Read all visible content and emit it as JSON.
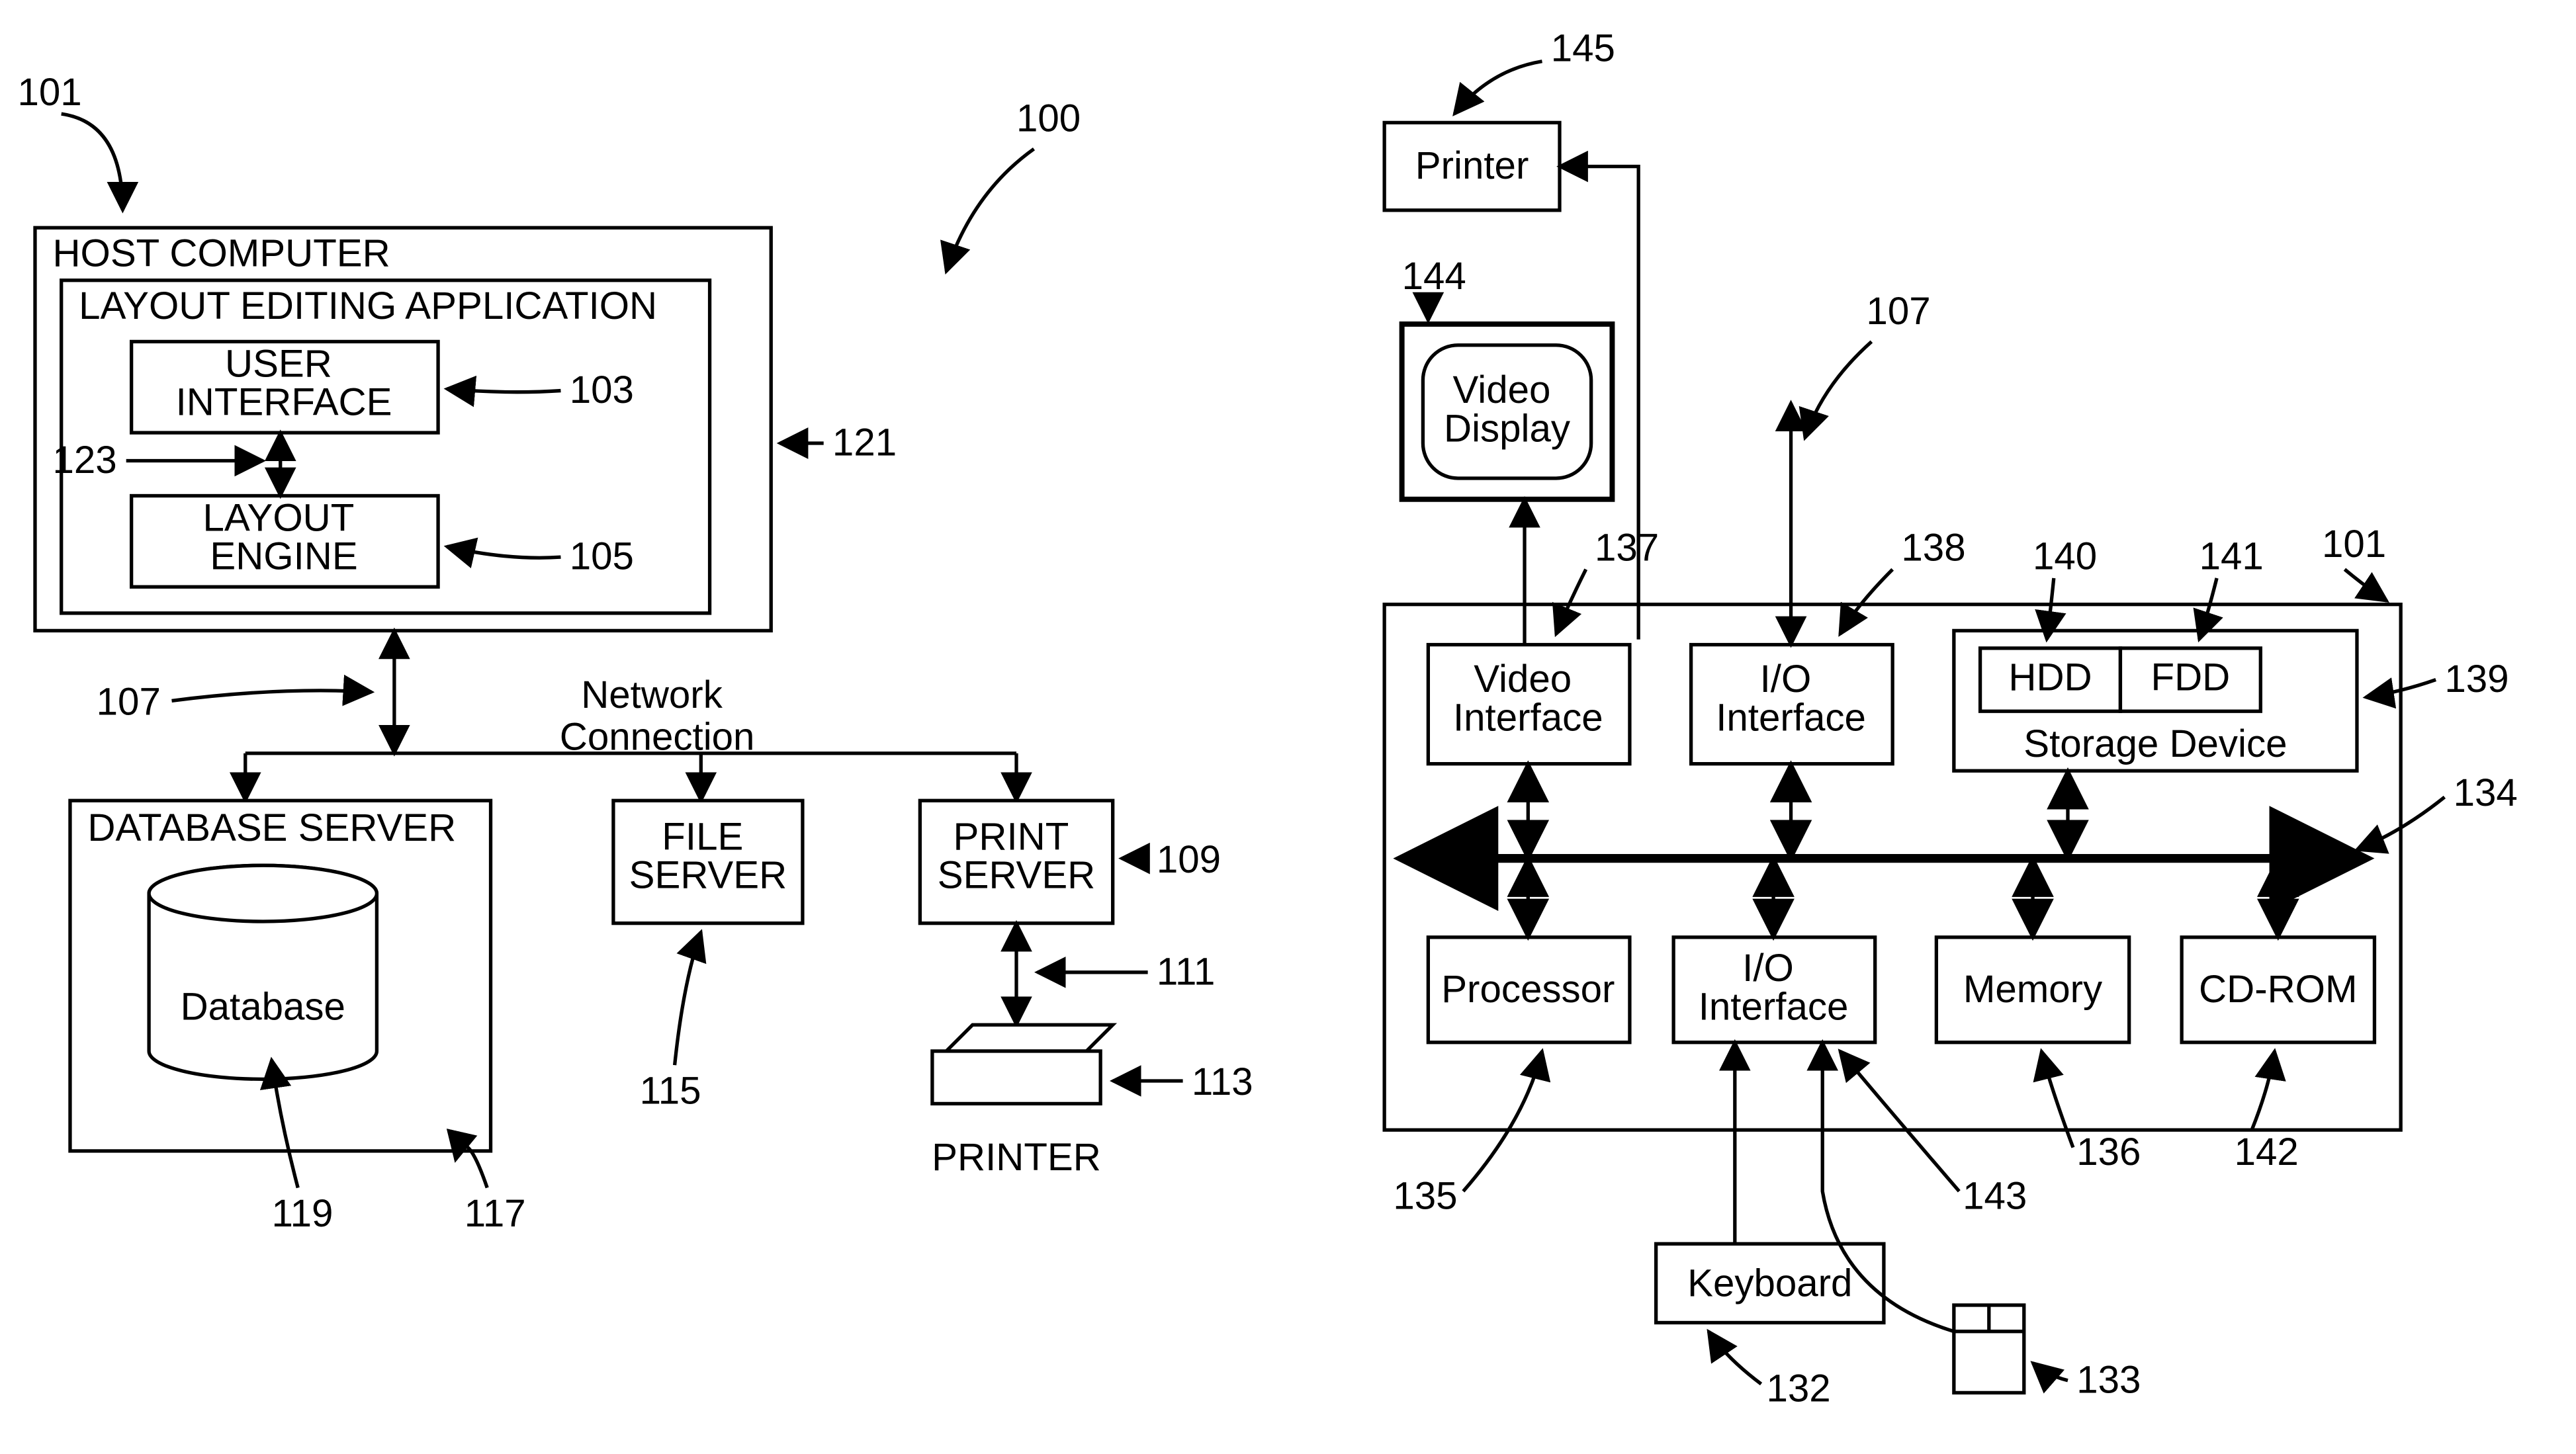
{
  "left": {
    "host_title": "HOST COMPUTER",
    "app_title": "LAYOUT EDITING APPLICATION",
    "ui": "USER\nINTERFACE",
    "engine": "LAYOUT\nENGINE",
    "net": "Network\nConnection",
    "db_server": "DATABASE SERVER",
    "database": "Database",
    "file_server": "FILE\nSERVER",
    "print_server": "PRINT\nSERVER",
    "printer": "PRINTER"
  },
  "right": {
    "printer": "Printer",
    "video_display": "Video\nDisplay",
    "video_if": "Video\nInterface",
    "io_if": "I/O\nInterface",
    "io_if2": "I/O\nInterface",
    "hdd": "HDD",
    "fdd": "FDD",
    "storage": "Storage Device",
    "processor": "Processor",
    "memory": "Memory",
    "cdrom": "CD-ROM",
    "keyboard": "Keyboard"
  },
  "refs": {
    "r100": "100",
    "r101": "101",
    "r103": "103",
    "r105": "105",
    "r107": "107",
    "r109": "109",
    "r111": "111",
    "r113": "113",
    "r115": "115",
    "r117": "117",
    "r119": "119",
    "r121": "121",
    "r123": "123",
    "r101b": "101",
    "r107b": "107",
    "r132": "132",
    "r133": "133",
    "r134": "134",
    "r135": "135",
    "r136": "136",
    "r137": "137",
    "r138": "138",
    "r139": "139",
    "r140": "140",
    "r141": "141",
    "r142": "142",
    "r143": "143",
    "r144": "144",
    "r145": "145"
  }
}
